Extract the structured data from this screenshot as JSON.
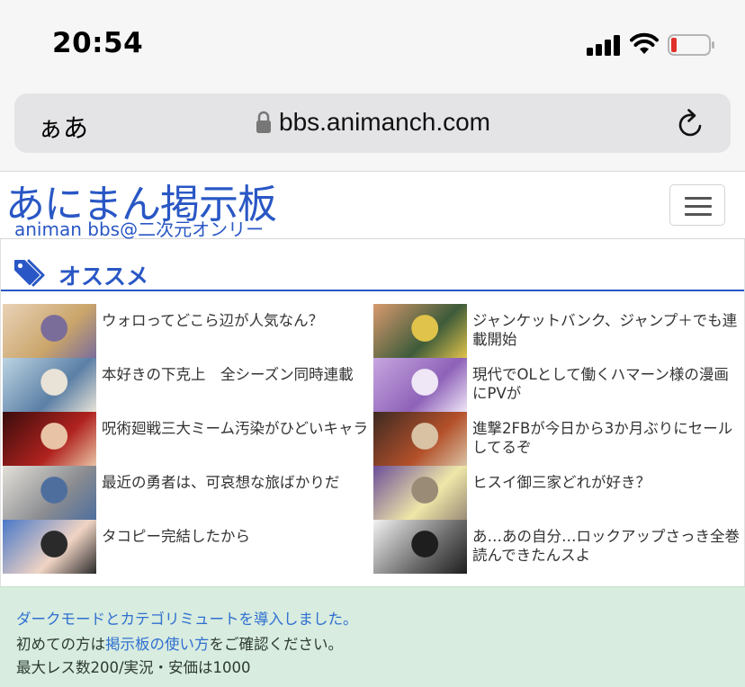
{
  "status": {
    "time": "20:54"
  },
  "browser": {
    "aa_label": "ぁあ",
    "url": "bbs.animanch.com"
  },
  "site": {
    "title": "あにまん掲示板",
    "subtitle": "animan bbs@二次元オンリー"
  },
  "recommend": {
    "title": "オススメ",
    "items": [
      {
        "text": "ウォロってどこら辺が人気なん？",
        "thumb_colors": [
          "#e9d2b7",
          "#caa56a",
          "#7b6d9a"
        ]
      },
      {
        "text": "ジャンケットバンク、ジャンプ＋でも連載開始",
        "thumb_colors": [
          "#d89a6e",
          "#3e5b3a",
          "#e0c34a"
        ]
      },
      {
        "text": "本好きの下克上　全シーズン同時連載",
        "thumb_colors": [
          "#bcd4e2",
          "#5b7fa6",
          "#e8e3d6"
        ]
      },
      {
        "text": "現代でOLとして働くハマーン様の漫画にPVが",
        "thumb_colors": [
          "#c7a6e0",
          "#8e62b8",
          "#efe6f6"
        ]
      },
      {
        "text": "呪術廻戦三大ミーム汚染がひどいキャラ",
        "thumb_colors": [
          "#3a0d0d",
          "#b0221e",
          "#e9c3a5"
        ]
      },
      {
        "text": "進撃2FBが今日から3か月ぶりにセールしてるぞ",
        "thumb_colors": [
          "#3d2a22",
          "#b3502a",
          "#d9c2a4"
        ]
      },
      {
        "text": "最近の勇者は、可哀想な旅ばかりだ",
        "thumb_colors": [
          "#e3e0d8",
          "#8a8c90",
          "#4e6e9e"
        ]
      },
      {
        "text": "ヒスイ御三家どれが好き？",
        "thumb_colors": [
          "#6b4e99",
          "#efe7a8",
          "#9a8b77"
        ]
      },
      {
        "text": "タコピー完結したから",
        "thumb_colors": [
          "#4a78c8",
          "#f0d4c4",
          "#2a2a2a"
        ]
      },
      {
        "text": "あ…あの自分…ロックアップさっき全巻読んできたんスよ",
        "thumb_colors": [
          "#f2f2f2",
          "#6a6a6a",
          "#1e1e1e"
        ]
      }
    ]
  },
  "notice": {
    "line1": "ダークモードとカテゴリミュートを導入しました。",
    "line2_pre": "初めての方は",
    "line2_link": "掲示板の使い方",
    "line2_post": "をご確認ください。",
    "line3": "最大レス数200/実況・安価は1000"
  },
  "colors": {
    "brand": "#2957c5",
    "notice_bg": "#d8ecdf",
    "link": "#2f6fd1",
    "battery_low": "#e0322b"
  }
}
